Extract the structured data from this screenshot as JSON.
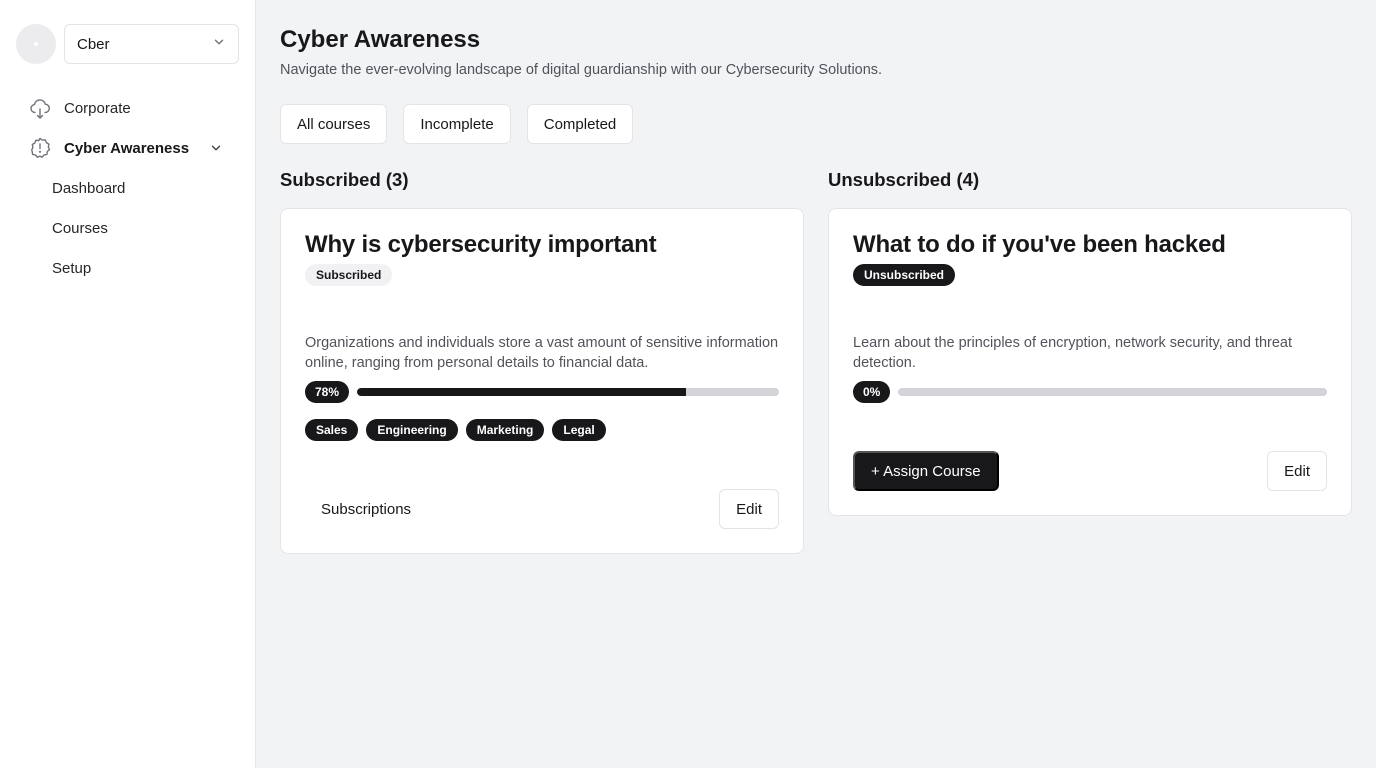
{
  "sidebar": {
    "org_select": {
      "value": "Cber"
    },
    "nav": [
      {
        "label": "Corporate",
        "icon": "cloud-icon"
      },
      {
        "label": "Cyber Awareness",
        "icon": "alert-badge-icon",
        "active": true
      }
    ],
    "sub_items": [
      "Dashboard",
      "Courses",
      "Setup"
    ]
  },
  "header": {
    "title": "Cyber Awareness",
    "subtitle": "Navigate the ever-evolving landscape of digital guardianship with our Cybersecurity Solutions."
  },
  "filters": [
    "All courses",
    "Incomplete",
    "Completed"
  ],
  "columns": {
    "subscribed_heading": "Subscribed (3)",
    "unsubscribed_heading": "Unsubscribed (4)"
  },
  "cards": [
    {
      "title": "Why is cybersecurity important",
      "badge": "Subscribed",
      "description": "Organizations and individuals store a vast amount of sensitive information online, ranging from personal details to financial data.",
      "progress_label": "78%",
      "progress": 0.78,
      "tags": [
        "Sales",
        "Engineering",
        "Marketing",
        "Legal"
      ],
      "subscriptions_label": "Subscriptions",
      "edit_label": "Edit"
    },
    {
      "title": "What to do if you've been hacked",
      "badge": "Unsubscribed",
      "description": "Learn about the principles of encryption, network security, and threat detection.",
      "progress_label": "0%",
      "progress": 0.0,
      "assign_label": "+ Assign Course",
      "edit_label": "Edit"
    }
  ],
  "colors": {
    "primary": "#18181b",
    "background": "#f2f3f5",
    "track": "#d4d4d8",
    "muted_text": "#52525b"
  }
}
